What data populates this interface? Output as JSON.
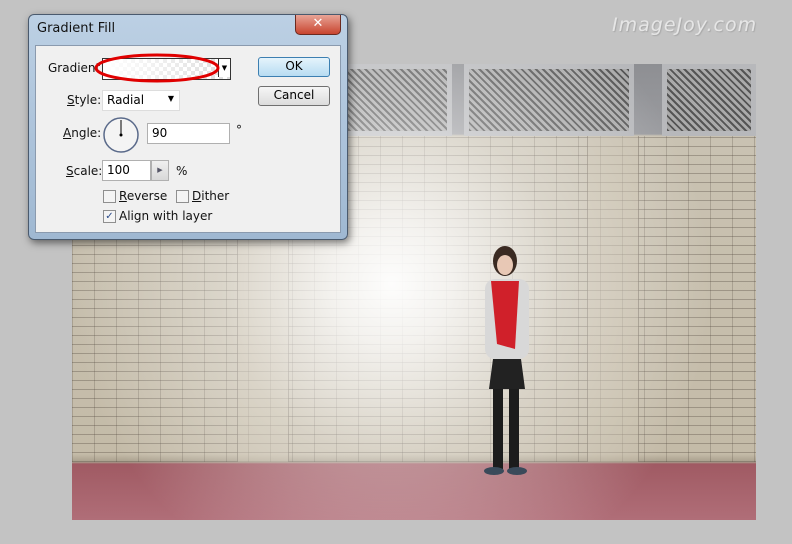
{
  "watermark": "ImageJoy.com",
  "dialog": {
    "title": "Gradient Fill",
    "close_icon": "close-x-icon",
    "gradient_label": "Gradient",
    "style_label": "Style:",
    "style_value": "Radial",
    "angle_label": "Angle:",
    "angle_value": "90",
    "angle_unit": "°",
    "scale_label": "Scale:",
    "scale_value": "100",
    "scale_unit": "%",
    "reverse_label": "Reverse",
    "reverse_checked": false,
    "dither_label": "Dither",
    "dither_checked": false,
    "align_label": "Align with layer",
    "align_checked": true,
    "ok_label": "OK",
    "cancel_label": "Cancel",
    "highlight_color": "#e00000"
  }
}
